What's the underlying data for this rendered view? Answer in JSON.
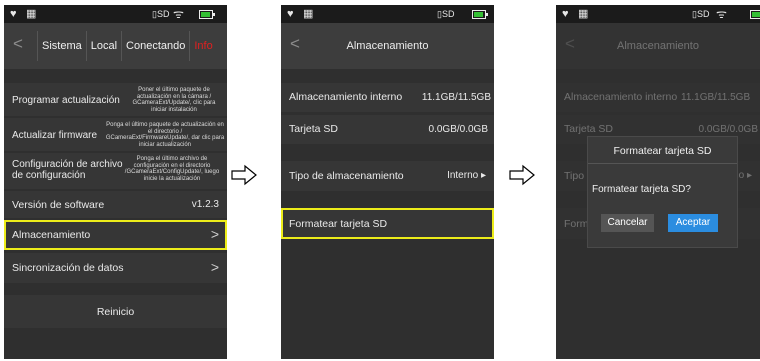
{
  "status": {
    "sd_label": "SD"
  },
  "screen1": {
    "back": "<",
    "tabs": [
      "Sistema",
      "Local",
      "Conectando",
      "Info"
    ],
    "items": [
      {
        "label": "Programar actualización",
        "desc": "Poner el último paquete de actualización en la cámara / GCameraExt/Update/, clic para iniciar instalación"
      },
      {
        "label": "Actualizar firmware",
        "desc": "Ponga el último paquete de actualización en el directorio / GCameraExt/FirmwareUpdate/, dar clic para iniciar actualización"
      },
      {
        "label": "Configuración de archivo de configuración",
        "desc": "Ponga el último archivo de configuración en el directorio /GCameraExt/ConfigUpdate/, luego inicie la actualización"
      },
      {
        "label": "Versión de software",
        "value": "v1.2.3"
      },
      {
        "label": "Almacenamiento",
        "chevron": ">"
      },
      {
        "label": "Sincronización de datos",
        "chevron": ">"
      }
    ],
    "reboot": "Reinicio"
  },
  "screen2": {
    "back": "<",
    "title": "Almacenamiento",
    "internal_label": "Almacenamiento interno",
    "internal_value": "11.1GB/11.5GB",
    "sd_label": "Tarjeta SD",
    "sd_value": "0.0GB/0.0GB",
    "type_label": "Tipo de almacenamiento",
    "type_value": "Interno ▸",
    "format_label": "Formatear tarjeta SD"
  },
  "screen3": {
    "back": "<",
    "title": "Almacenamiento",
    "internal_label": "Almacenamiento interno",
    "internal_value": "11.1GB/11.5GB",
    "sd_label": "Tarjeta SD",
    "sd_value": "0.0GB/0.0GB",
    "type_label": "Tipo d",
    "type_value": "rno ▸",
    "format_label": "Form",
    "dialog": {
      "title": "Formatear tarjeta SD",
      "message": "Formatear tarjeta SD?",
      "cancel": "Cancelar",
      "accept": "Aceptar"
    }
  },
  "colors": {
    "highlight": "#ecec1a",
    "accept_button": "#2b8de0",
    "info_tab": "#e02020",
    "battery": "#35c035"
  }
}
